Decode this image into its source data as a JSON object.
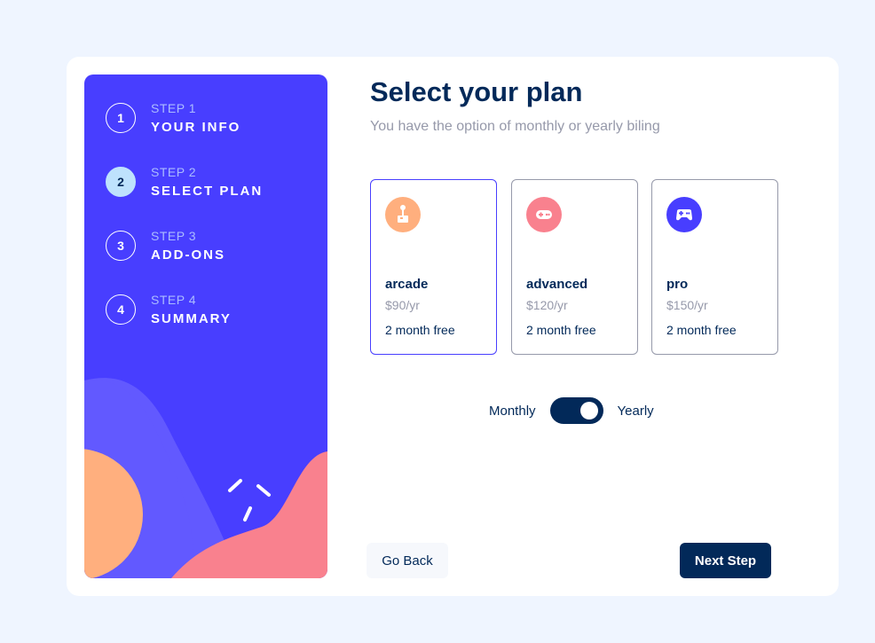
{
  "steps": [
    {
      "number": "1",
      "label": "STEP 1",
      "title": "YOUR INFO",
      "active": false
    },
    {
      "number": "2",
      "label": "STEP 2",
      "title": "SELECT PLAN",
      "active": true
    },
    {
      "number": "3",
      "label": "STEP 3",
      "title": "ADD-ONS",
      "active": false
    },
    {
      "number": "4",
      "label": "STEP 4",
      "title": "SUMMARY",
      "active": false
    }
  ],
  "main": {
    "title": "Select your plan",
    "subtitle": "You have the option of monthly or yearly biling"
  },
  "plans": [
    {
      "name": "arcade",
      "price": "$90/yr",
      "promo": "2 month free",
      "icon": "arcade-icon",
      "color": "#ffaf7e",
      "selected": true
    },
    {
      "name": "advanced",
      "price": "$120/yr",
      "promo": "2 month free",
      "icon": "gamepad-icon",
      "color": "#f9818e",
      "selected": false
    },
    {
      "name": "pro",
      "price": "$150/yr",
      "promo": "2 month free",
      "icon": "controller-icon",
      "color": "#483eff",
      "selected": false
    }
  ],
  "billing": {
    "monthly_label": "Monthly",
    "yearly_label": "Yearly",
    "selected": "Yearly"
  },
  "buttons": {
    "back": "Go Back",
    "next": "Next Step"
  },
  "colors": {
    "sidebar": "#483eff",
    "marine_blue": "#022959",
    "active_step": "#bee2fd",
    "page_bg": "#eff5ff"
  }
}
